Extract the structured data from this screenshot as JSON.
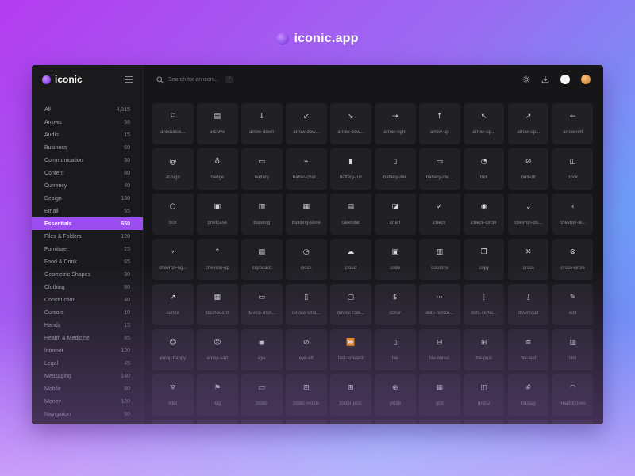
{
  "brand": {
    "title": "iconic.app"
  },
  "sidebar": {
    "logo_text": "iconic",
    "categories": [
      {
        "label": "All",
        "count": "4,315"
      },
      {
        "label": "Arrows",
        "count": "58"
      },
      {
        "label": "Audio",
        "count": "15"
      },
      {
        "label": "Business",
        "count": "60"
      },
      {
        "label": "Communication",
        "count": "30"
      },
      {
        "label": "Content",
        "count": "80"
      },
      {
        "label": "Currency",
        "count": "40"
      },
      {
        "label": "Design",
        "count": "180"
      },
      {
        "label": "Email",
        "count": "55"
      },
      {
        "label": "Essentials",
        "count": "650",
        "active": true
      },
      {
        "label": "Files & Folders",
        "count": "120"
      },
      {
        "label": "Furniture",
        "count": "25"
      },
      {
        "label": "Food & Drink",
        "count": "65"
      },
      {
        "label": "Geometric Shapes",
        "count": "30"
      },
      {
        "label": "Clothing",
        "count": "80"
      },
      {
        "label": "Construction",
        "count": "40"
      },
      {
        "label": "Cursors",
        "count": "10"
      },
      {
        "label": "Hands",
        "count": "15"
      },
      {
        "label": "Health & Medicine",
        "count": "85"
      },
      {
        "label": "Internet",
        "count": "120"
      },
      {
        "label": "Legal",
        "count": "45"
      },
      {
        "label": "Messaging",
        "count": "140"
      },
      {
        "label": "Mobile",
        "count": "80"
      },
      {
        "label": "Money",
        "count": "120"
      },
      {
        "label": "Navigation",
        "count": "50"
      }
    ]
  },
  "topbar": {
    "search_placeholder": "Search for an icon...",
    "shortcut": "/"
  },
  "colors": {
    "accent": "#9b4df0",
    "panel": "#161618",
    "tile": "#212125"
  },
  "icons": [
    {
      "label": "announce...",
      "glyph": "⚐",
      "icon": "announcement-icon"
    },
    {
      "label": "archive",
      "glyph": "▤",
      "icon": "archive-icon"
    },
    {
      "label": "arrow-down",
      "glyph": "↓",
      "icon": "arrow-down-icon"
    },
    {
      "label": "arrow-dow...",
      "glyph": "↙",
      "icon": "arrow-down-left-icon"
    },
    {
      "label": "arrow-dow...",
      "glyph": "↘",
      "icon": "arrow-down-right-icon"
    },
    {
      "label": "arrow-right",
      "glyph": "→",
      "icon": "arrow-right-icon"
    },
    {
      "label": "arrow-up",
      "glyph": "↑",
      "icon": "arrow-up-icon"
    },
    {
      "label": "arrow-up...",
      "glyph": "↖",
      "icon": "arrow-up-left-icon"
    },
    {
      "label": "arrow-up...",
      "glyph": "↗",
      "icon": "arrow-up-right-icon"
    },
    {
      "label": "arrow-left",
      "glyph": "←",
      "icon": "arrow-left-icon"
    },
    {
      "label": "at-sign",
      "glyph": "@",
      "icon": "at-sign-icon"
    },
    {
      "label": "badge",
      "glyph": "♁",
      "icon": "badge-icon"
    },
    {
      "label": "battery",
      "glyph": "▭",
      "icon": "battery-icon"
    },
    {
      "label": "batter-char...",
      "glyph": "⌁",
      "icon": "battery-charging-icon"
    },
    {
      "label": "battery-full",
      "glyph": "▮",
      "icon": "battery-full-icon"
    },
    {
      "label": "battery-low",
      "glyph": "▯",
      "icon": "battery-low-icon"
    },
    {
      "label": "battery-me...",
      "glyph": "▭",
      "icon": "battery-medium-icon"
    },
    {
      "label": "bell",
      "glyph": "◔",
      "icon": "bell-icon"
    },
    {
      "label": "bell-off",
      "glyph": "⊘",
      "icon": "bell-off-icon"
    },
    {
      "label": "book",
      "glyph": "◫",
      "icon": "book-icon"
    },
    {
      "label": "box",
      "glyph": "⬡",
      "icon": "box-icon"
    },
    {
      "label": "briefcase",
      "glyph": "▣",
      "icon": "briefcase-icon"
    },
    {
      "label": "building",
      "glyph": "▥",
      "icon": "building-icon"
    },
    {
      "label": "building-store",
      "glyph": "▦",
      "icon": "building-store-icon"
    },
    {
      "label": "calendar",
      "glyph": "▤",
      "icon": "calendar-icon"
    },
    {
      "label": "chart",
      "glyph": "◪",
      "icon": "chart-icon"
    },
    {
      "label": "check",
      "glyph": "✓",
      "icon": "check-icon"
    },
    {
      "label": "check-circle",
      "glyph": "◉",
      "icon": "check-circle-icon"
    },
    {
      "label": "chevron-do...",
      "glyph": "⌄",
      "icon": "chevron-down-icon"
    },
    {
      "label": "chevron-le...",
      "glyph": "‹",
      "icon": "chevron-left-icon"
    },
    {
      "label": "chevron-rig...",
      "glyph": "›",
      "icon": "chevron-right-icon"
    },
    {
      "label": "chevron-up",
      "glyph": "⌃",
      "icon": "chevron-up-icon"
    },
    {
      "label": "clipboard",
      "glyph": "▤",
      "icon": "clipboard-icon"
    },
    {
      "label": "clock",
      "glyph": "◷",
      "icon": "clock-icon"
    },
    {
      "label": "cloud",
      "glyph": "☁",
      "icon": "cloud-icon"
    },
    {
      "label": "code",
      "glyph": "▣",
      "icon": "code-icon"
    },
    {
      "label": "columns",
      "glyph": "▥",
      "icon": "columns-icon"
    },
    {
      "label": "copy",
      "glyph": "❐",
      "icon": "copy-icon"
    },
    {
      "label": "cross",
      "glyph": "✕",
      "icon": "cross-icon"
    },
    {
      "label": "cross-circle",
      "glyph": "⊗",
      "icon": "cross-circle-icon"
    },
    {
      "label": "cursor",
      "glyph": "➚",
      "icon": "cursor-icon"
    },
    {
      "label": "dashboard",
      "glyph": "▦",
      "icon": "dashboard-icon"
    },
    {
      "label": "device-mon...",
      "glyph": "▭",
      "icon": "device-monitor-icon"
    },
    {
      "label": "device-sma...",
      "glyph": "▯",
      "icon": "device-smartphone-icon"
    },
    {
      "label": "device-tabl...",
      "glyph": "▢",
      "icon": "device-tablet-icon"
    },
    {
      "label": "dollar",
      "glyph": "$",
      "icon": "dollar-icon"
    },
    {
      "label": "dots-horizo...",
      "glyph": "···",
      "icon": "dots-horizontal-icon"
    },
    {
      "label": "dots-vertic...",
      "glyph": "⋮",
      "icon": "dots-vertical-icon"
    },
    {
      "label": "download",
      "glyph": "⤓",
      "icon": "download-icon"
    },
    {
      "label": "edit",
      "glyph": "✎",
      "icon": "edit-icon"
    },
    {
      "label": "emoji-happy",
      "glyph": "☺",
      "icon": "emoji-happy-icon"
    },
    {
      "label": "emoji-sad",
      "glyph": "☹",
      "icon": "emoji-sad-icon"
    },
    {
      "label": "eye",
      "glyph": "◉",
      "icon": "eye-icon"
    },
    {
      "label": "eye-off",
      "glyph": "⊘",
      "icon": "eye-off-icon"
    },
    {
      "label": "fast-forward",
      "glyph": "⏩",
      "icon": "fast-forward-icon"
    },
    {
      "label": "file",
      "glyph": "▯",
      "icon": "file-icon"
    },
    {
      "label": "file-minus",
      "glyph": "⊟",
      "icon": "file-minus-icon"
    },
    {
      "label": "file-plus",
      "glyph": "⊞",
      "icon": "file-plus-icon"
    },
    {
      "label": "file-text",
      "glyph": "≡",
      "icon": "file-text-icon"
    },
    {
      "label": "film",
      "glyph": "▥",
      "icon": "film-icon"
    },
    {
      "label": "filter",
      "glyph": "⛛",
      "icon": "filter-icon"
    },
    {
      "label": "flag",
      "glyph": "⚑",
      "icon": "flag-icon"
    },
    {
      "label": "folder",
      "glyph": "▭",
      "icon": "folder-icon"
    },
    {
      "label": "folder-minus",
      "glyph": "⊟",
      "icon": "folder-minus-icon"
    },
    {
      "label": "folder-plus",
      "glyph": "⊞",
      "icon": "folder-plus-icon"
    },
    {
      "label": "globe",
      "glyph": "⊕",
      "icon": "globe-icon"
    },
    {
      "label": "grid",
      "glyph": "▦",
      "icon": "grid-icon"
    },
    {
      "label": "grid-2",
      "glyph": "◫",
      "icon": "grid-2-icon"
    },
    {
      "label": "hastag",
      "glyph": "#",
      "icon": "hashtag-icon"
    },
    {
      "label": "headphones",
      "glyph": "◠",
      "icon": "headphones-icon"
    },
    {
      "label": "",
      "glyph": "",
      "icon": "blank-icon"
    },
    {
      "label": "",
      "glyph": "",
      "icon": "blank-icon"
    },
    {
      "label": "",
      "glyph": "",
      "icon": "blank-icon"
    },
    {
      "label": "",
      "glyph": "",
      "icon": "blank-icon"
    },
    {
      "label": "",
      "glyph": "",
      "icon": "blank-icon"
    },
    {
      "label": "",
      "glyph": "",
      "icon": "blank-icon"
    },
    {
      "label": "",
      "glyph": "",
      "icon": "blank-icon"
    },
    {
      "label": "",
      "glyph": "",
      "icon": "blank-icon"
    },
    {
      "label": "",
      "glyph": "",
      "icon": "blank-icon"
    },
    {
      "label": "",
      "glyph": "",
      "icon": "blank-icon"
    }
  ]
}
